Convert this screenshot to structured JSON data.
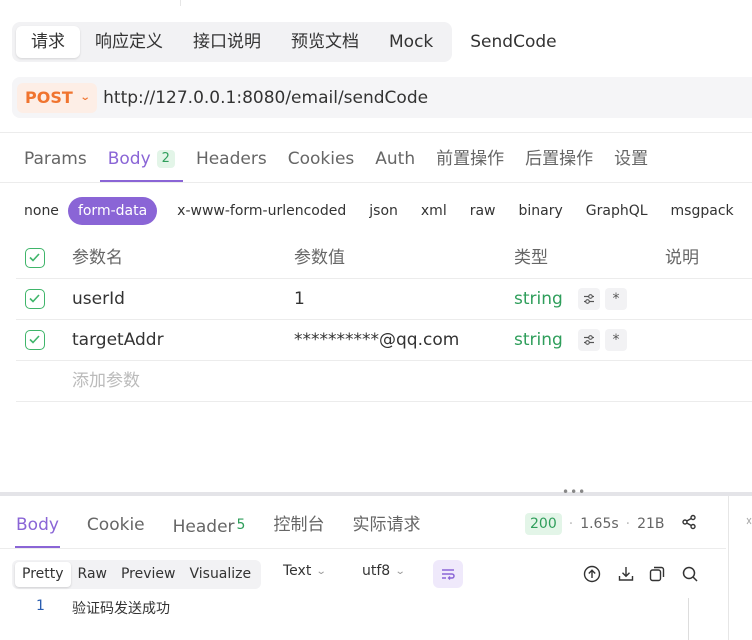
{
  "top_tabs": {
    "group": [
      "请求",
      "响应定义",
      "接口说明",
      "预览文档",
      "Mock"
    ],
    "active_index": 0,
    "extra": "SendCode"
  },
  "request": {
    "method": "POST",
    "url": "http://127.0.0.1:8080/email/sendCode"
  },
  "req_tabs": [
    {
      "label": "Params"
    },
    {
      "label": "Body",
      "badge": "2",
      "active": true
    },
    {
      "label": "Headers"
    },
    {
      "label": "Cookies"
    },
    {
      "label": "Auth"
    },
    {
      "label": "前置操作"
    },
    {
      "label": "后置操作"
    },
    {
      "label": "设置"
    }
  ],
  "body_types": [
    "none",
    "form-data",
    "x-www-form-urlencoded",
    "json",
    "xml",
    "raw",
    "binary",
    "GraphQL",
    "msgpack"
  ],
  "body_type_active": "form-data",
  "params_table": {
    "headers": {
      "name": "参数名",
      "value": "参数值",
      "type": "类型",
      "desc": "说明"
    },
    "rows": [
      {
        "name": "userId",
        "value": "1",
        "type": "string",
        "required_mark": "*"
      },
      {
        "name": "targetAddr",
        "value": "**********@qq.com",
        "type": "string",
        "required_mark": "*"
      }
    ],
    "add_placeholder": "添加参数"
  },
  "splitter_handle": "•••",
  "response": {
    "tabs": [
      {
        "label": "Body",
        "active": true
      },
      {
        "label": "Cookie"
      },
      {
        "label": "Header",
        "badge": "5"
      },
      {
        "label": "控制台"
      },
      {
        "label": "实际请求"
      }
    ],
    "status": "200",
    "time": "1.65s",
    "size": "21B",
    "view_modes": [
      "Pretty",
      "Raw",
      "Preview",
      "Visualize"
    ],
    "view_active": "Pretty",
    "format": "Text",
    "encoding": "utf8",
    "line_number": "1",
    "body_text": "验证码发送成功"
  },
  "colors": {
    "accent": "#8a65d6",
    "method": "#f0742f",
    "success": "#2f9e5b"
  }
}
